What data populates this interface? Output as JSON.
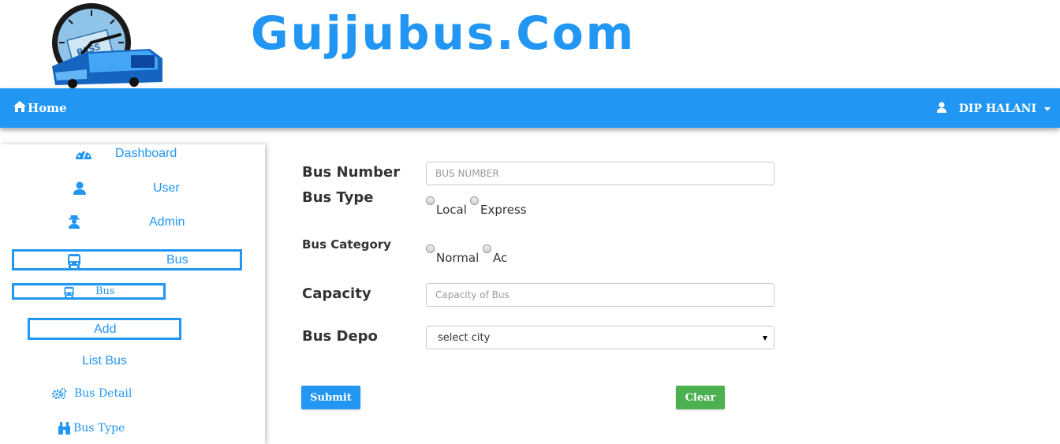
{
  "brand": {
    "title": "Gujjubus.Com",
    "logo_text": "PASS"
  },
  "navbar": {
    "home_label": "Home",
    "user_name": "DIP HALANI"
  },
  "sidebar": {
    "items": [
      {
        "label": "Dashboard",
        "icon": "dashboard-icon"
      },
      {
        "label": "User",
        "icon": "user-icon"
      },
      {
        "label": "Admin",
        "icon": "admin-icon"
      },
      {
        "label": "Bus",
        "icon": "bus-icon"
      },
      {
        "label": "Bus",
        "icon": "bus-icon"
      },
      {
        "label": "Add"
      },
      {
        "label": "List Bus"
      },
      {
        "label": "Bus Detail",
        "icon": "cogs-icon"
      },
      {
        "label": "Bus Type",
        "icon": "binoculars-icon"
      }
    ]
  },
  "form": {
    "bus_number": {
      "label": "Bus Number",
      "placeholder": "BUS NUMBER",
      "value": ""
    },
    "bus_type": {
      "label": "Bus Type",
      "options": [
        "Local",
        "Express"
      ]
    },
    "bus_category": {
      "label": "Bus Category",
      "options": [
        "Normal",
        "Ac"
      ]
    },
    "capacity": {
      "label": "Capacity",
      "placeholder": "Capacity of Bus",
      "value": ""
    },
    "bus_depo": {
      "label": "Bus Depo",
      "selected": "select city"
    },
    "submit_label": "Submit",
    "clear_label": "Clear"
  },
  "colors": {
    "primary": "#2196f3",
    "success": "#4caf50",
    "text": "#333333"
  }
}
